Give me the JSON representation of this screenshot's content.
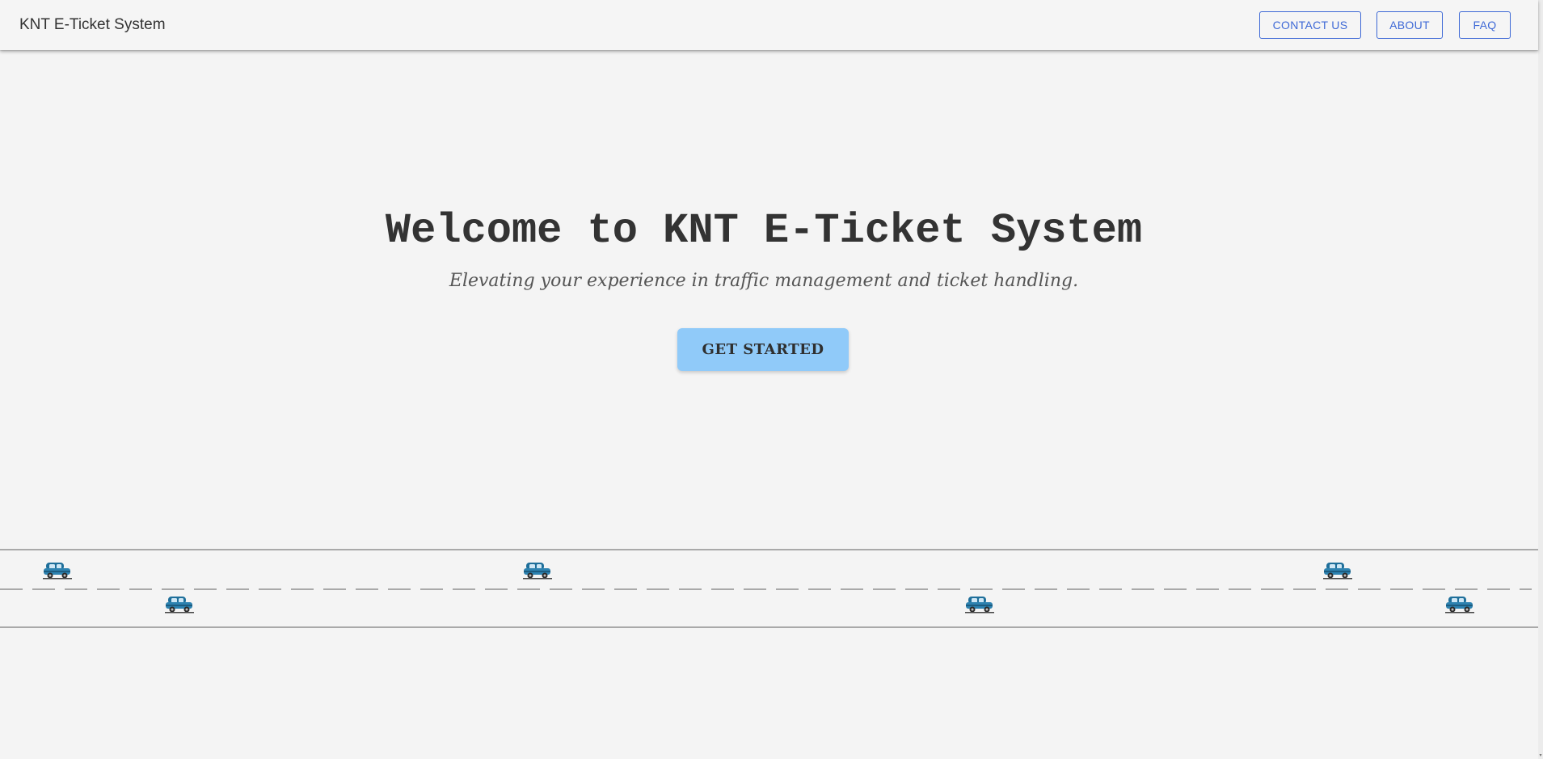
{
  "header": {
    "brand": "KNT E-Ticket System",
    "nav": [
      {
        "label": "CONTACT US"
      },
      {
        "label": "ABOUT"
      },
      {
        "label": "FAQ"
      }
    ]
  },
  "hero": {
    "title": "Welcome to KNT E-Ticket System",
    "subtitle": "Elevating your experience in traffic management and ticket handling.",
    "cta_label": "GET STARTED"
  },
  "road": {
    "car_icon": "car-icon",
    "car_count": 7
  },
  "colors": {
    "background": "#f4f4f4",
    "nav_accent": "#3e69d6",
    "cta_background": "#90caf9",
    "title_text": "#333333",
    "car_body": "#1f6f9a"
  }
}
